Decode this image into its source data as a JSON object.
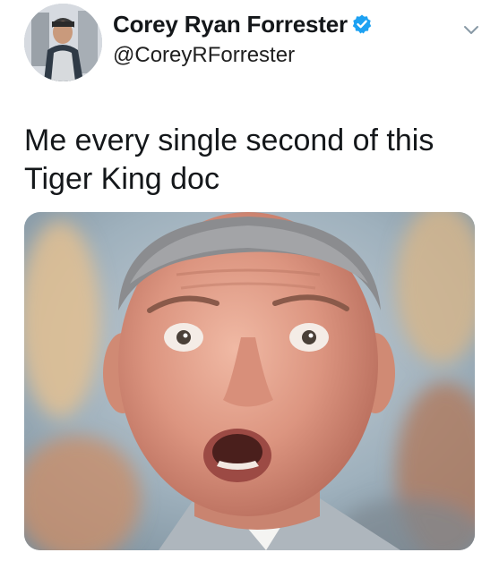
{
  "tweet": {
    "author": {
      "display_name": "Corey Ryan Forrester",
      "handle": "@CoreyRForrester",
      "verified": true,
      "avatar_icon": "profile-photo"
    },
    "text_line_1": "Me every single second of this",
    "text_line_2": "Tiger King doc",
    "menu_icon": "chevron-down-icon",
    "media_icon": "shocked-man-photo",
    "colors": {
      "verified_badge": "#1da1f2",
      "text": "#14171a",
      "chevron": "#8899a6"
    }
  }
}
